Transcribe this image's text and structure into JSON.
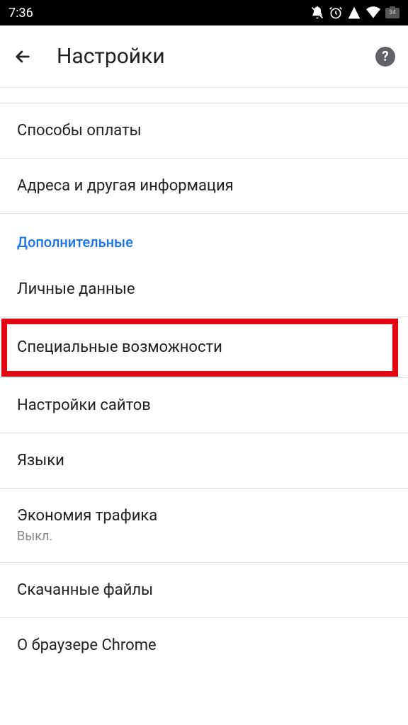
{
  "status": {
    "time": "7:36",
    "battery": "34"
  },
  "header": {
    "title": "Настройки"
  },
  "rows": {
    "payment": "Способы оплаты",
    "addresses": "Адреса и другая информация",
    "section_extra": "Дополнительные",
    "personal": "Личные данные",
    "accessibility": "Специальные возможности",
    "site_settings": "Настройки сайтов",
    "languages": "Языки",
    "data_saver": "Экономия трафика",
    "data_saver_sub": "Выкл.",
    "downloads": "Скачанные файлы",
    "about": "О браузере Chrome"
  }
}
